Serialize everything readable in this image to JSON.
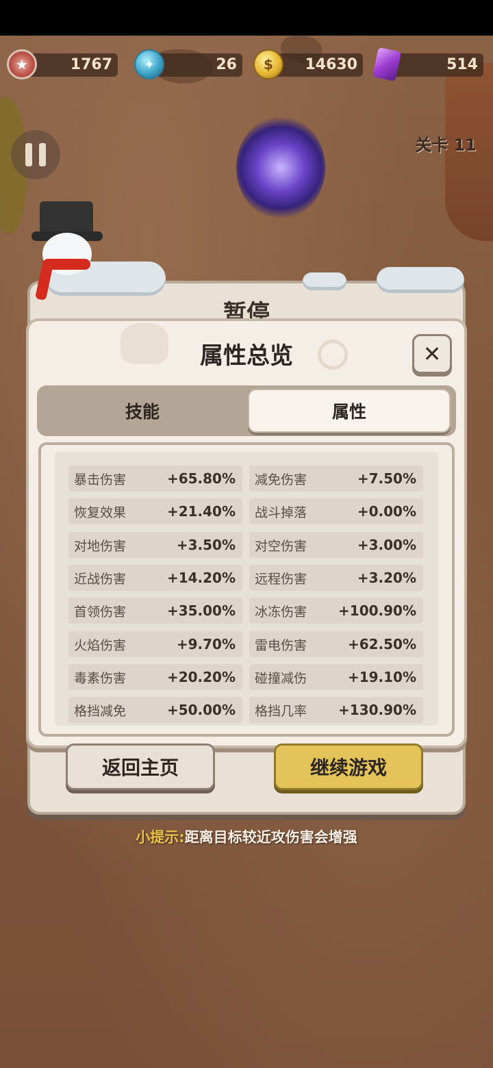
{
  "resources": {
    "medal": "1767",
    "gems": "26",
    "coins": "14630",
    "crystals": "514"
  },
  "level_label": "关卡 11",
  "pause_title": "暂停",
  "modal": {
    "title": "属性总览",
    "close": "✕",
    "tabs": {
      "skill": "技能",
      "attr": "属性"
    },
    "stats_left": [
      {
        "label": "暴击伤害",
        "value": "+65.80%"
      },
      {
        "label": "恢复效果",
        "value": "+21.40%"
      },
      {
        "label": "对地伤害",
        "value": "+3.50%"
      },
      {
        "label": "近战伤害",
        "value": "+14.20%"
      },
      {
        "label": "首领伤害",
        "value": "+35.00%"
      },
      {
        "label": "火焰伤害",
        "value": "+9.70%"
      },
      {
        "label": "毒素伤害",
        "value": "+20.20%"
      },
      {
        "label": "格挡减免",
        "value": "+50.00%"
      }
    ],
    "stats_right": [
      {
        "label": "减免伤害",
        "value": "+7.50%"
      },
      {
        "label": "战斗掉落",
        "value": "+0.00%"
      },
      {
        "label": "对空伤害",
        "value": "+3.00%"
      },
      {
        "label": "远程伤害",
        "value": "+3.20%"
      },
      {
        "label": "冰冻伤害",
        "value": "+100.90%"
      },
      {
        "label": "雷电伤害",
        "value": "+62.50%"
      },
      {
        "label": "碰撞减伤",
        "value": "+19.10%"
      },
      {
        "label": "格挡几率",
        "value": "+130.90%"
      }
    ]
  },
  "buttons": {
    "home": "返回主页",
    "continue": "继续游戏"
  },
  "tip": {
    "label": "小提示:",
    "text": "距离目标较近攻伤害会增强"
  }
}
